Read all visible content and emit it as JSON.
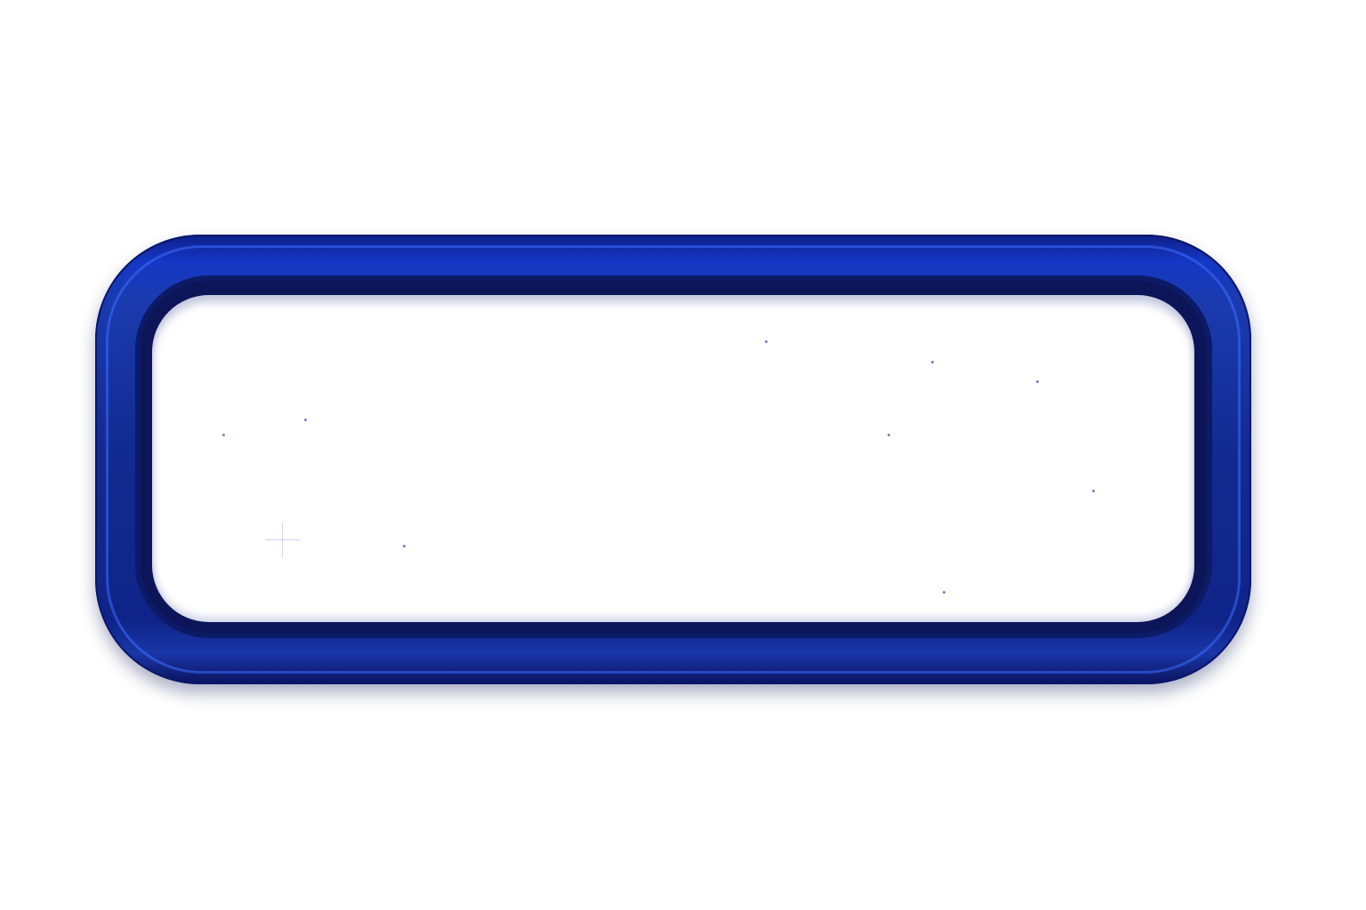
{
  "frame": {
    "style": "rounded-rectangle-blue-border",
    "border_color": "#1a36a8",
    "border_dark": "#0b1558",
    "border_highlight": "#1e4bd6",
    "fill_color": "#ffffff"
  },
  "panel": {
    "text": ""
  }
}
